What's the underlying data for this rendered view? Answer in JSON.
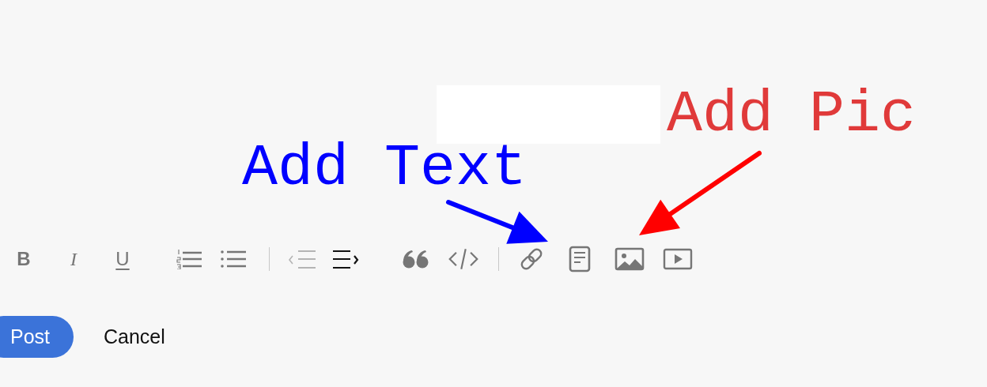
{
  "toolbar": [
    {
      "kind": "bold",
      "label": "B",
      "disabled": false
    },
    {
      "kind": "italic",
      "label": "I",
      "disabled": false
    },
    {
      "kind": "underline",
      "label": "U",
      "disabled": false
    },
    {
      "kind": "ordered-list",
      "disabled": false
    },
    {
      "kind": "bullet-list",
      "disabled": false
    },
    {
      "kind": "divider"
    },
    {
      "kind": "outdent",
      "disabled": true
    },
    {
      "kind": "indent",
      "disabled": false
    },
    {
      "kind": "quote",
      "disabled": false
    },
    {
      "kind": "code",
      "disabled": false
    },
    {
      "kind": "divider"
    },
    {
      "kind": "link",
      "disabled": false
    },
    {
      "kind": "document",
      "disabled": false
    },
    {
      "kind": "image",
      "disabled": false
    },
    {
      "kind": "video",
      "disabled": false
    }
  ],
  "actions": [
    {
      "kind": "primary",
      "label": "Post"
    },
    {
      "kind": "plain",
      "label": "Cancel"
    }
  ],
  "annotations": [
    {
      "kind": "redaction"
    },
    {
      "kind": "label",
      "text": "Add Text",
      "color": "#0000ff"
    },
    {
      "kind": "label",
      "text": "Add Pic",
      "color": "#e03a3a"
    },
    {
      "kind": "arrow",
      "color": "#0000ff"
    },
    {
      "kind": "arrow",
      "color": "#ff0000"
    }
  ]
}
